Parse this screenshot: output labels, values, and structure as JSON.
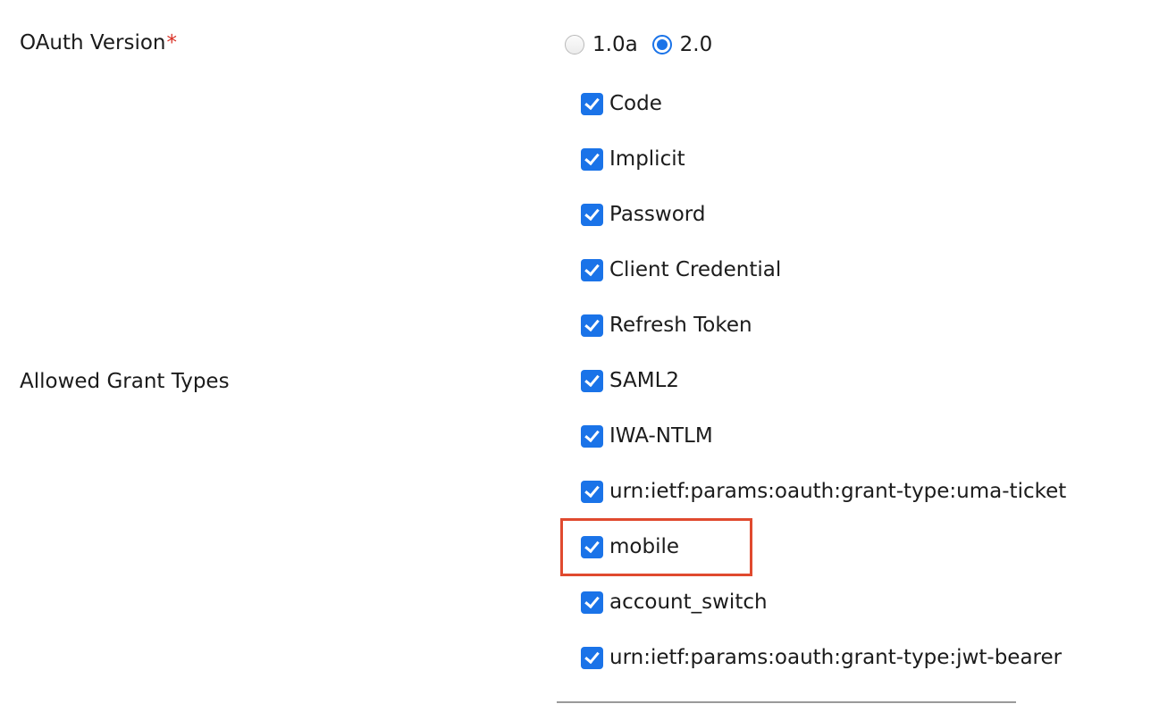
{
  "oauth_version": {
    "label": "OAuth Version",
    "required_mark": "*",
    "options": [
      {
        "label": "1.0a",
        "selected": false
      },
      {
        "label": "2.0",
        "selected": true
      }
    ]
  },
  "grant_types": {
    "label": "Allowed Grant Types",
    "items": [
      {
        "label": "Code",
        "checked": true
      },
      {
        "label": "Implicit",
        "checked": true
      },
      {
        "label": "Password",
        "checked": true
      },
      {
        "label": "Client Credential",
        "checked": true
      },
      {
        "label": "Refresh Token",
        "checked": true
      },
      {
        "label": "SAML2",
        "checked": true
      },
      {
        "label": "IWA-NTLM",
        "checked": true
      },
      {
        "label": "urn:ietf:params:oauth:grant-type:uma-ticket",
        "checked": true
      },
      {
        "label": "mobile",
        "checked": true
      },
      {
        "label": "account_switch",
        "checked": true
      },
      {
        "label": "urn:ietf:params:oauth:grant-type:jwt-bearer",
        "checked": true
      }
    ]
  },
  "colors": {
    "accent": "#1a73e8",
    "required": "#d93025",
    "highlight": "#e04a2f"
  }
}
